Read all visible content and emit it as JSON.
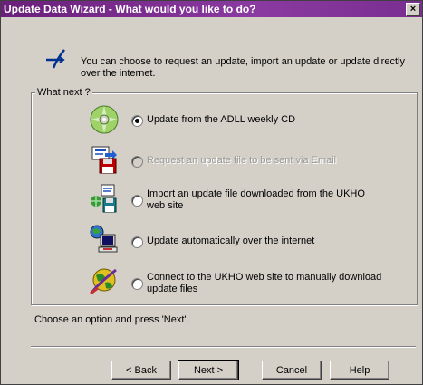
{
  "window": {
    "title": "Update Data Wizard - What would you like to do?",
    "close_glyph": "×"
  },
  "intro": {
    "icon": "wizard-arrow-icon",
    "text": "You can choose to request an update, import an update or update directly over the internet."
  },
  "group": {
    "label": "What next ?"
  },
  "options": [
    {
      "icon": "cd-disc-icon",
      "label": "Update from the ADLL weekly CD",
      "checked": true,
      "enabled": true
    },
    {
      "icon": "email-floppy-icon",
      "label": "Request an update file to be sent via Email",
      "checked": false,
      "enabled": false
    },
    {
      "icon": "download-file-icon",
      "label": "Import an update file downloaded from the UKHO web site",
      "checked": false,
      "enabled": true
    },
    {
      "icon": "internet-computer-icon",
      "label": "Update automatically over the internet",
      "checked": false,
      "enabled": true
    },
    {
      "icon": "globe-web-icon",
      "label": "Connect to the UKHO web site to manually download update files",
      "checked": false,
      "enabled": true
    }
  ],
  "status": {
    "text": "Choose an option and press 'Next'."
  },
  "buttons": {
    "back": "< Back",
    "next": "Next >",
    "cancel": "Cancel",
    "help": "Help"
  },
  "colors": {
    "titlebar": "#7a2e90",
    "dialog_bg": "#d4d0c8"
  }
}
